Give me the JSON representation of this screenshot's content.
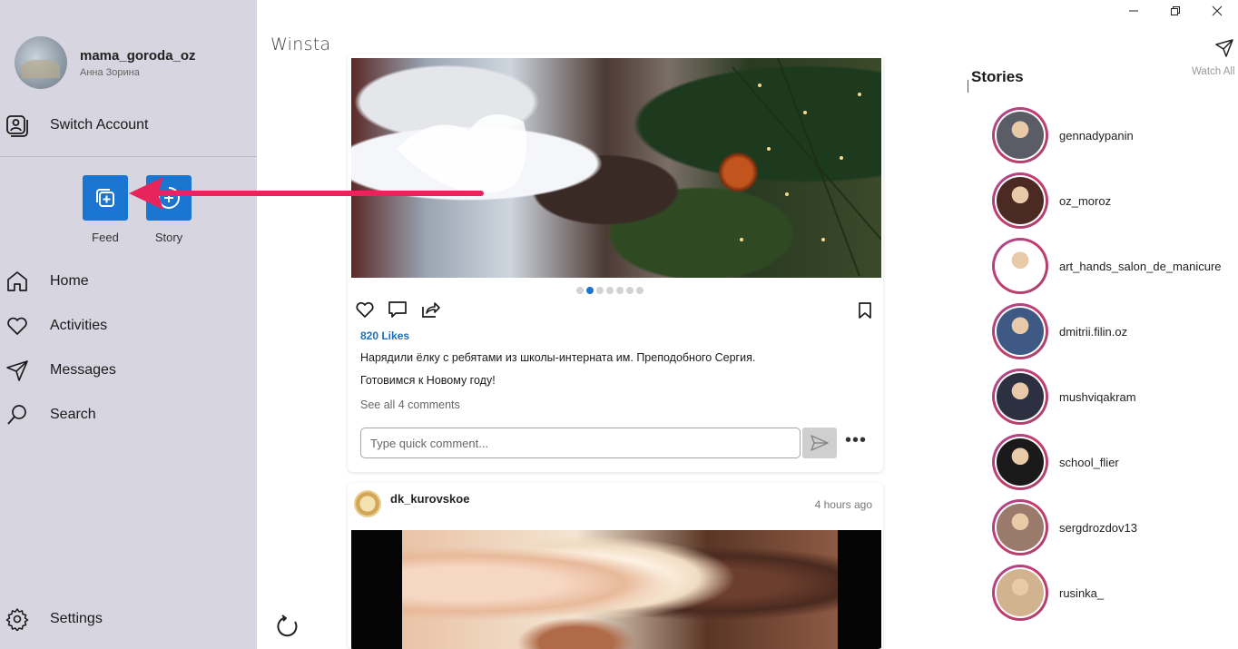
{
  "window": {
    "minimize_icon": "minimize-icon",
    "restore_icon": "restore-icon",
    "close_icon": "close-icon"
  },
  "sidebar": {
    "profile": {
      "username": "mama_goroda_oz",
      "fullname": "Анна Зорина"
    },
    "switch_account": "Switch Account",
    "create": {
      "feed_label": "Feed",
      "story_label": "Story"
    },
    "nav": {
      "home": "Home",
      "activities": "Activities",
      "messages": "Messages",
      "search": "Search"
    },
    "settings": "Settings"
  },
  "app": {
    "brand": "Winsta",
    "accent": "#1b76d1",
    "arrow_color": "#e8245c"
  },
  "feed": {
    "post1": {
      "carousel": {
        "count": 7,
        "active": 1
      },
      "likes": "820 Likes",
      "caption_line1": "Нарядили ёлку с ребятами из школы-интерната им. Преподобного Сергия.",
      "caption_line2": "Готовимся к Новому году!",
      "see_all_comments": "See all 4 comments",
      "comment_placeholder": "Type quick comment...",
      "more": "•••"
    },
    "post2": {
      "username": "dk_kurovskoe",
      "time": "4 hours ago"
    }
  },
  "stories": {
    "title": "Stories",
    "watch_all": "Watch All",
    "items": [
      {
        "name": "gennadypanin",
        "color": "#5a5d66"
      },
      {
        "name": "oz_moroz",
        "color": "#4a2a22"
      },
      {
        "name": "art_hands_salon_de_manicure",
        "color": "#ffffff"
      },
      {
        "name": "dmitrii.filin.oz",
        "color": "#3e5a84"
      },
      {
        "name": "mushviqakram",
        "color": "#2c3040"
      },
      {
        "name": "school_flier",
        "color": "#1a1a1a"
      },
      {
        "name": "sergdrozdov13",
        "color": "#9a7a6a"
      },
      {
        "name": "rusinka_",
        "color": "#d2b390"
      }
    ]
  }
}
